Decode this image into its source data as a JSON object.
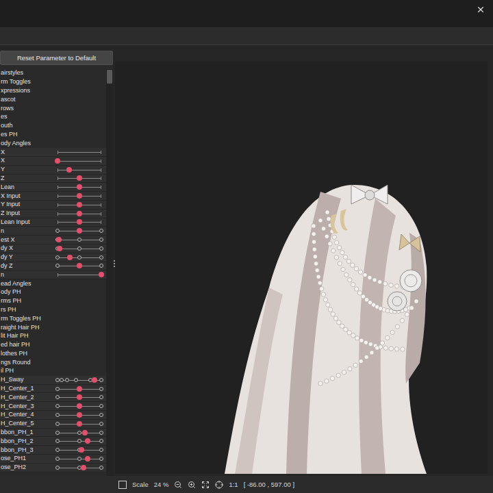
{
  "window": {
    "close": "×"
  },
  "panel": {
    "reset_button": "Reset Parameter to Default",
    "rows": [
      {
        "kind": "group",
        "label": "airstyles"
      },
      {
        "kind": "group",
        "label": "rm Toggles"
      },
      {
        "kind": "group",
        "label": "xpressions"
      },
      {
        "kind": "group",
        "label": "ascot"
      },
      {
        "kind": "group",
        "label": "rows"
      },
      {
        "kind": "group",
        "label": "es"
      },
      {
        "kind": "group",
        "label": "outh"
      },
      {
        "kind": "group",
        "label": "es PH"
      },
      {
        "kind": "group",
        "label": "ody Angles"
      },
      {
        "kind": "track",
        "label": "X"
      },
      {
        "kind": "slider",
        "label": "X",
        "level": 0
      },
      {
        "kind": "slider",
        "label": "Y",
        "level": 0.27
      },
      {
        "kind": "slider",
        "label": "Z",
        "level": 0.5
      },
      {
        "kind": "slider",
        "label": "Lean",
        "level": 0.5
      },
      {
        "kind": "slider",
        "label": "X Input",
        "level": 0.5
      },
      {
        "kind": "slider",
        "label": "Y Input",
        "level": 0.5
      },
      {
        "kind": "slider",
        "label": "Z Input",
        "level": 0.5
      },
      {
        "kind": "slider",
        "label": "Lean Input",
        "level": 0.5
      },
      {
        "kind": "keys",
        "label": "n",
        "level": 0.5,
        "keys": [
          0,
          0.5,
          1
        ]
      },
      {
        "kind": "keys",
        "label": "est X",
        "level": 0.03,
        "keys": [
          0,
          0.5,
          1
        ]
      },
      {
        "kind": "keys",
        "label": "dy X",
        "level": 0.05,
        "keys": [
          0,
          0.5,
          1
        ]
      },
      {
        "kind": "keys",
        "label": "dy Y",
        "level": 0.28,
        "keys": [
          0,
          0.5,
          1
        ]
      },
      {
        "kind": "keys",
        "label": "dy Z",
        "level": 0.5,
        "keys": [
          0,
          0.5,
          1
        ]
      },
      {
        "kind": "slider",
        "label": "n",
        "level": 1
      },
      {
        "kind": "group",
        "label": "ead Angles"
      },
      {
        "kind": "group",
        "label": "ody PH"
      },
      {
        "kind": "group",
        "label": "rms PH"
      },
      {
        "kind": "group",
        "label": "rs PH"
      },
      {
        "kind": "group",
        "label": "rm Toggles PH"
      },
      {
        "kind": "group",
        "label": "raight Hair PH"
      },
      {
        "kind": "group",
        "label": "lit Hair PH"
      },
      {
        "kind": "group",
        "label": "ed hair PH"
      },
      {
        "kind": "group",
        "label": "lothes PH"
      },
      {
        "kind": "group",
        "label": "ngs Round"
      },
      {
        "kind": "group",
        "label": "il PH"
      },
      {
        "kind": "keys",
        "label": "H_Sway",
        "level": 0.85,
        "keys": [
          0,
          0.1,
          0.22,
          0.42,
          0.75,
          1
        ]
      },
      {
        "kind": "keys",
        "label": "H_Center_1",
        "level": 0.5,
        "keys": [
          0,
          0.5,
          1
        ]
      },
      {
        "kind": "keys",
        "label": "H_Center_2",
        "level": 0.5,
        "keys": [
          0,
          0.5,
          1
        ]
      },
      {
        "kind": "keys",
        "label": "H_Center_3",
        "level": 0.5,
        "keys": [
          0,
          0.5,
          1
        ]
      },
      {
        "kind": "keys",
        "label": "H_Center_4",
        "level": 0.5,
        "keys": [
          0,
          0.5,
          1
        ]
      },
      {
        "kind": "keys",
        "label": "H_Center_5",
        "level": 0.5,
        "keys": [
          0,
          0.5,
          1
        ]
      },
      {
        "kind": "keys",
        "label": "bbon_PH_1",
        "level": 0.62,
        "keys": [
          0,
          0.5,
          1
        ]
      },
      {
        "kind": "keys",
        "label": "bbon_PH_2",
        "level": 0.68,
        "keys": [
          0,
          0.5,
          1
        ]
      },
      {
        "kind": "keys",
        "label": "bbon_PH_3",
        "level": 0.55,
        "keys": [
          0,
          0.5,
          1
        ]
      },
      {
        "kind": "keys",
        "label": "ose_PH1",
        "level": 0.68,
        "keys": [
          0,
          0.5,
          1
        ]
      },
      {
        "kind": "keys",
        "label": "ose_PH2",
        "level": 0.6,
        "keys": [
          0,
          0.5,
          1
        ]
      }
    ]
  },
  "status_bar": {
    "checkbox_checked": false,
    "scale_label": "Scale",
    "scale_value": "24 %",
    "ratio": "1:1",
    "coords": "[ -86.00 , 597.00 ]"
  }
}
